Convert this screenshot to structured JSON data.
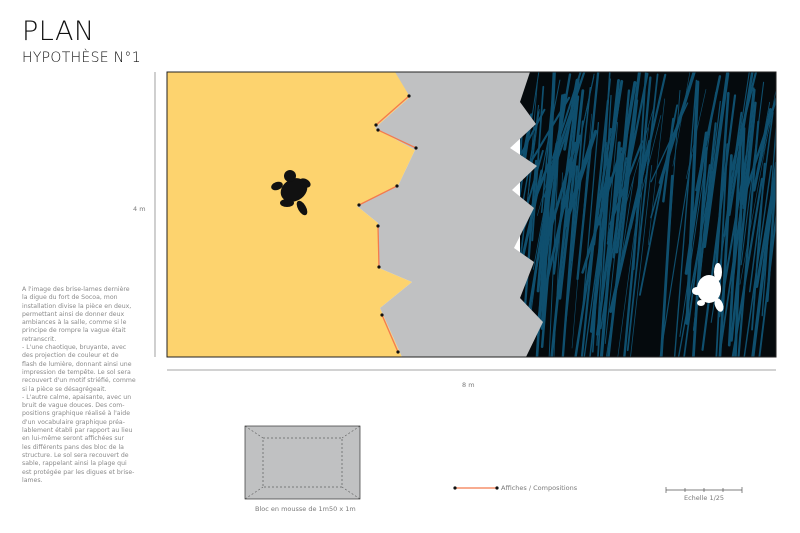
{
  "header": {
    "title": "PLAN",
    "subtitle": "HYPOTHÈSE N°1"
  },
  "description": "A l'image des brise-lames dernière\nla digue du fort de Socoa, mon\ninstallation divise la pièce en deux,\npermettant ainsi de donner deux\nambiances à la salle, comme si le\nprincipe de rompre la vague était\nretranscrit.\n- L'une chaotique, bruyante, avec\ndes projection de couleur et de\nflash de lumière, donnant ainsi une\nimpression de tempête. Le sol sera\nrecouvert d'un motif striéfié, comme\nsi la pièce se désagrégeait.\n- L'autre calme, apaisante, avec un\nbruit de vague douces. Des com-\npositions graphique réalisé à l'aide\nd'un vocabulaire graphique préa-\nlablement établi par rapport au lieu\nen lui-même seront affichées sur\nles différents pans des bloc de la\nstructure. Le sol sera recouvert de\nsable, rappelant ainsi la plage qui\nest protégée par les digues et brise-\nlames.",
  "dimensions": {
    "height_label": "4 m",
    "width_label": "8 m"
  },
  "legend": {
    "block_label": "Bloc en mousse de 1m50 x 1m",
    "posters_label": "Affiches / Compositions",
    "scale_label": "Echelle 1/25"
  },
  "colors": {
    "sand": "#fdd36e",
    "wall": "#c0c1c2",
    "sea": "#0f4f6e",
    "poster": "#f37a4e",
    "frame": "#222222"
  }
}
